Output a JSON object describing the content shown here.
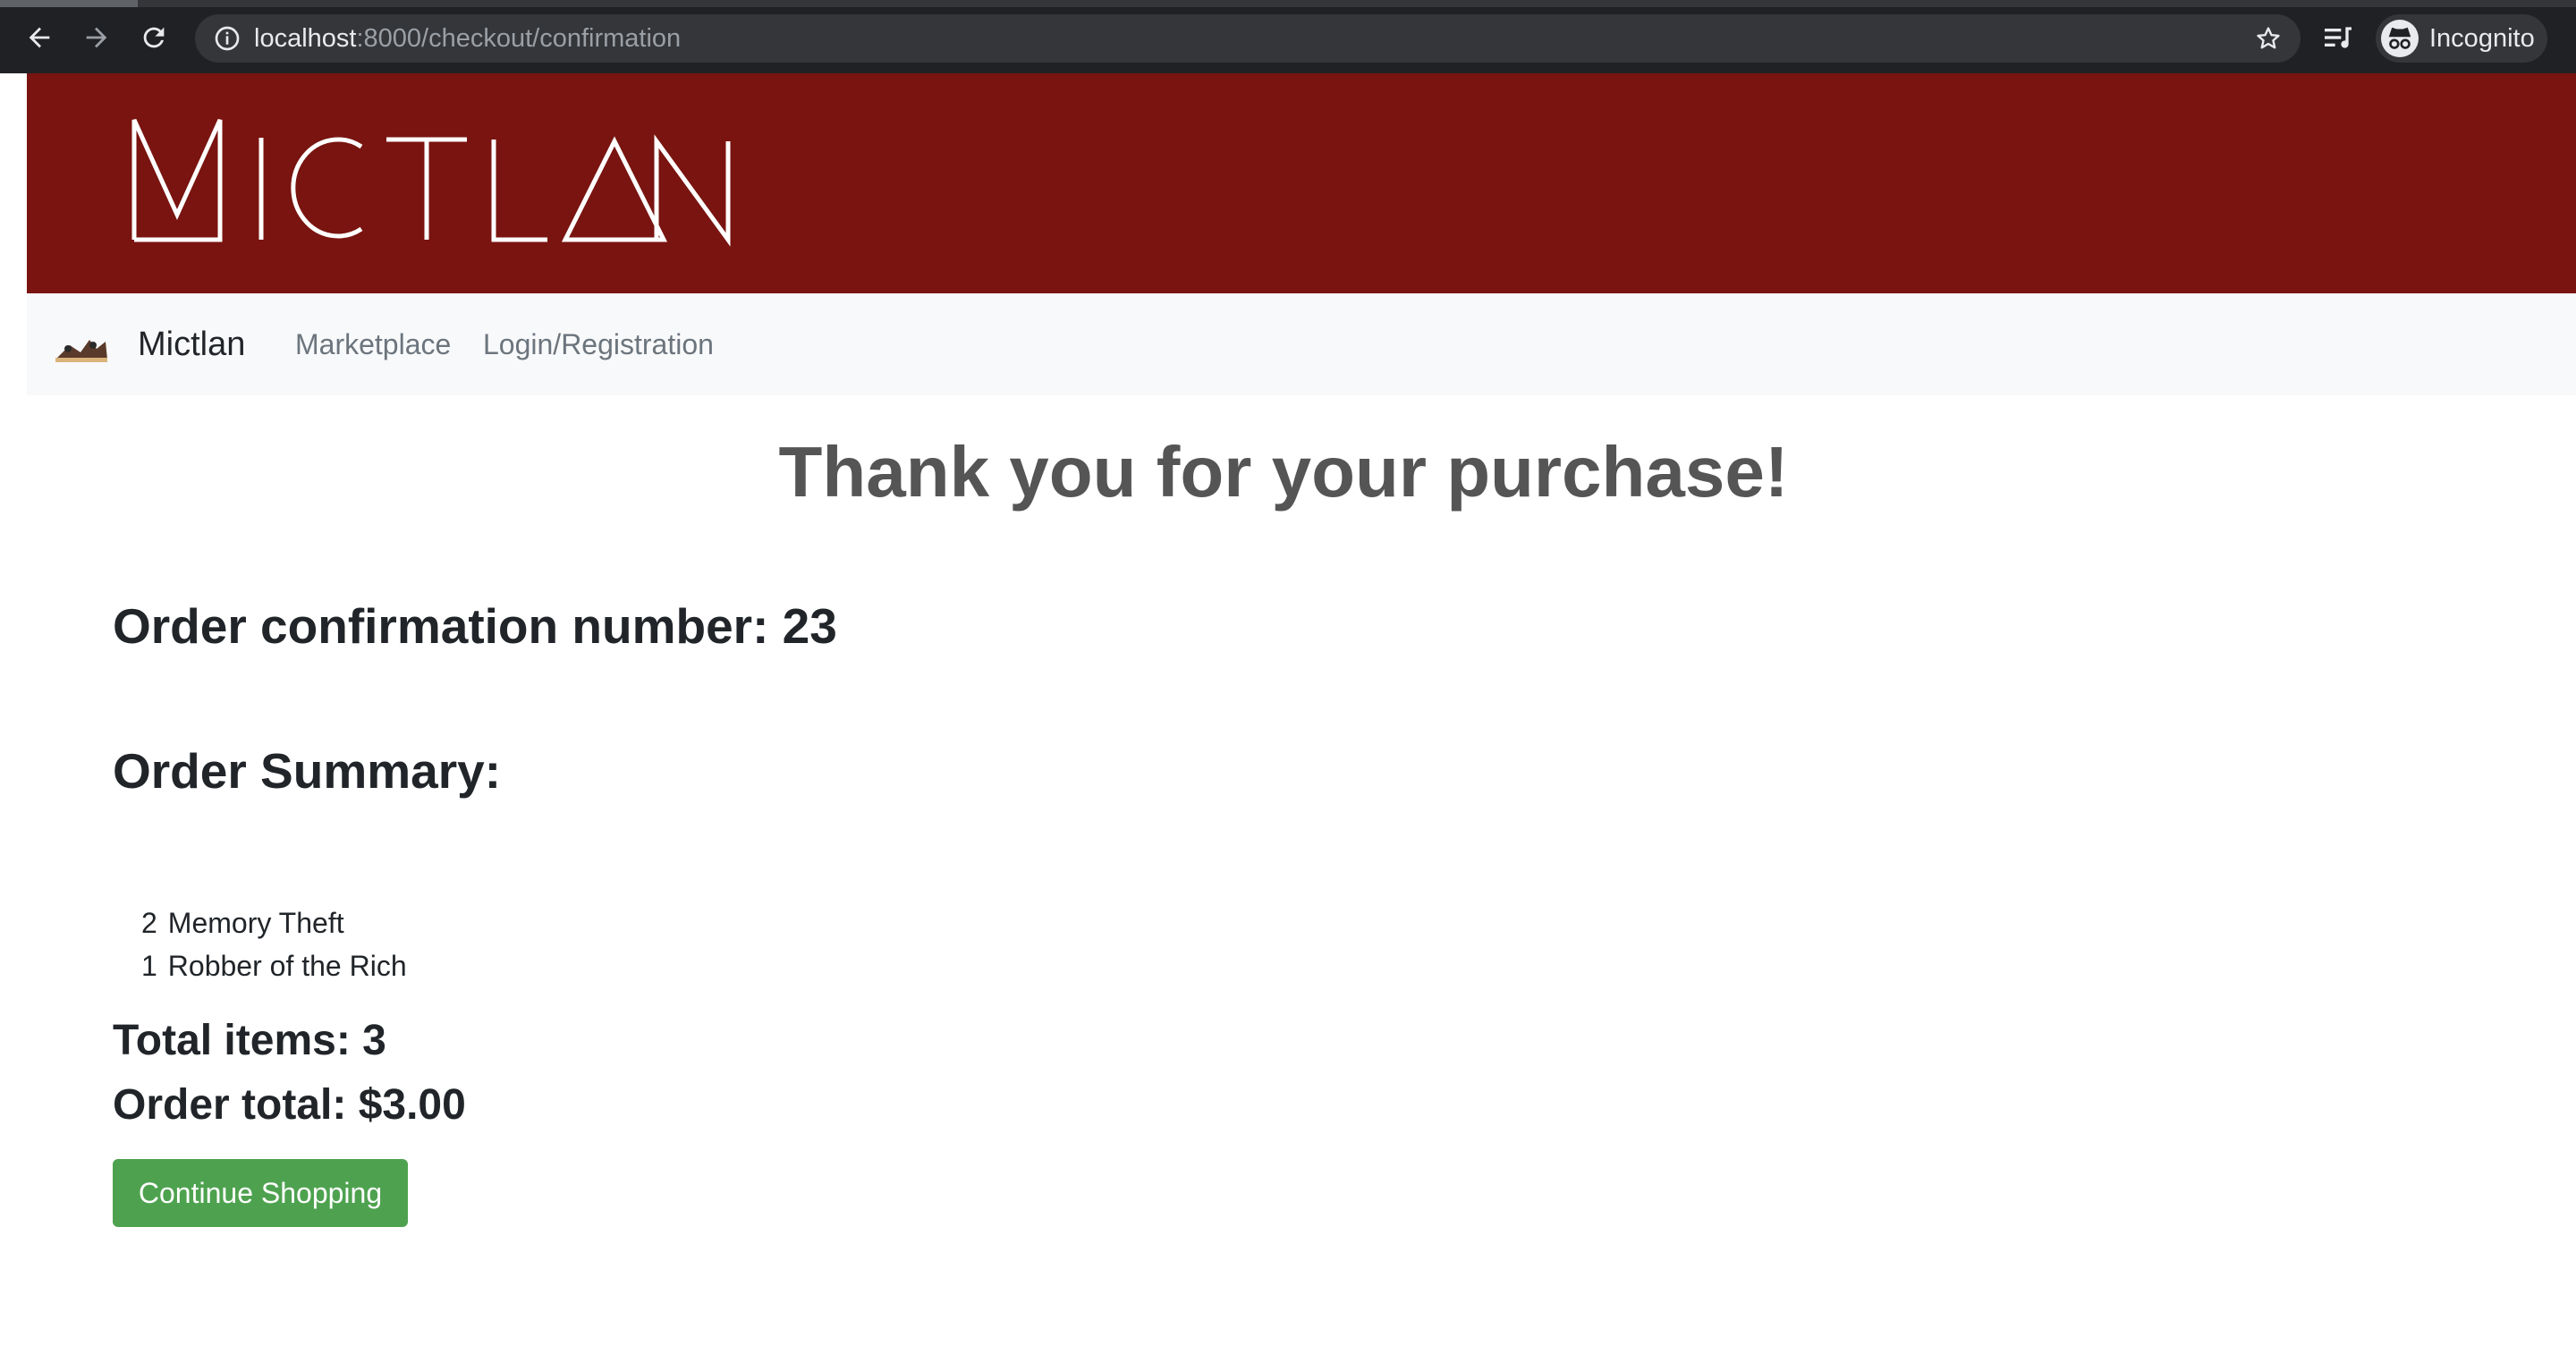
{
  "browser": {
    "url_host": "localhost",
    "url_path": ":8000/checkout/confirmation",
    "profile_label": "Incognito",
    "icons": [
      "back-icon",
      "forward-icon",
      "reload-icon",
      "info-icon",
      "star-icon",
      "media-control-icon",
      "incognito-icon"
    ]
  },
  "site": {
    "banner_logo_text": "MICTLAN",
    "brand_name": "Mictlan",
    "nav": {
      "marketplace": "Marketplace",
      "login": "Login/Registration"
    },
    "colors": {
      "banner": "#791410",
      "navbar": "#f8f9fa",
      "button": "#4ea24f"
    }
  },
  "confirmation": {
    "heading": "Thank you for your purchase!",
    "order_number_text": "Order confirmation number: 23",
    "summary_title": "Order Summary:",
    "items": [
      {
        "qty": "2",
        "name": "Memory Theft"
      },
      {
        "qty": "1",
        "name": "Robber of the Rich"
      }
    ],
    "total_items_text": "Total items: 3",
    "order_total_text": "Order total: $3.00",
    "continue_label": "Continue Shopping"
  }
}
